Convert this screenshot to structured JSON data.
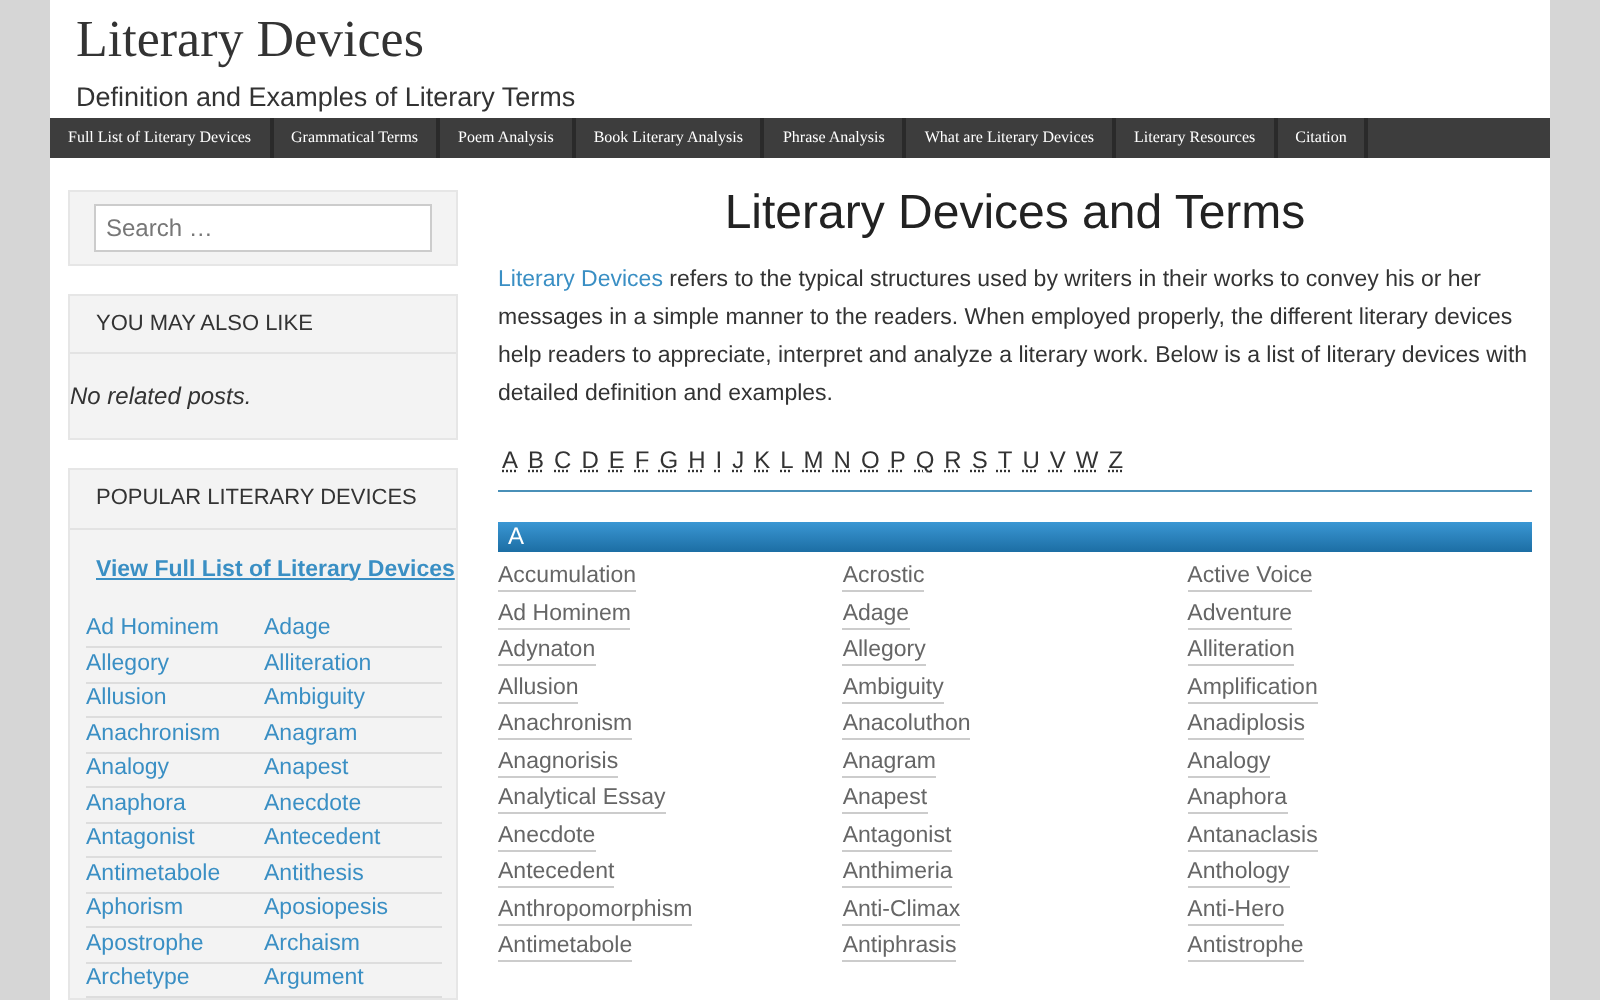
{
  "site": {
    "title": "Literary Devices",
    "tagline": "Definition and Examples of Literary Terms"
  },
  "nav": [
    "Full List of Literary Devices",
    "Grammatical Terms",
    "Poem Analysis",
    "Book Literary Analysis",
    "Phrase Analysis",
    "What are Literary Devices",
    "Literary Resources",
    "Citation"
  ],
  "sidebar": {
    "search": {
      "placeholder": "Search …"
    },
    "related": {
      "heading": "YOU MAY ALSO LIKE",
      "text": "No related posts."
    },
    "popular": {
      "heading": "POPULAR LITERARY DEVICES",
      "link": "View Full List of Literary Devices",
      "items": [
        "Ad Hominem",
        "Adage",
        "Allegory",
        "Alliteration",
        "Allusion",
        "Ambiguity",
        "Anachronism",
        "Anagram",
        "Analogy",
        "Anapest",
        "Anaphora",
        "Anecdote",
        "Antagonist",
        "Antecedent",
        "Antimetabole",
        "Antithesis",
        "Aphorism",
        "Aposiopesis",
        "Apostrophe",
        "Archaism",
        "Archetype",
        "Argument"
      ]
    }
  },
  "main": {
    "title": "Literary Devices and Terms",
    "intro_link": "Literary Devices",
    "intro": " refers to the typical structures used by writers in their works to convey his or her messages in a simple manner to the readers.  When employed properly, the different literary devices help readers to appreciate, interpret and analyze a literary work. Below is a list of literary devices with detailed definition and examples.",
    "letters": [
      "A",
      "B",
      "C",
      "D",
      "E",
      "F",
      "G",
      "H",
      "I",
      "J",
      "K",
      "L",
      "M",
      "N",
      "O",
      "P",
      "Q",
      "R",
      "S",
      "T",
      "U",
      "V",
      "W",
      "Z"
    ],
    "section": {
      "heading": "A",
      "terms": [
        "Accumulation",
        "Acrostic",
        "Active Voice",
        "Ad Hominem",
        "Adage",
        "Adventure",
        "Adynaton",
        "Allegory",
        "Alliteration",
        "Allusion",
        "Ambiguity",
        "Amplification",
        "Anachronism",
        "Anacoluthon",
        "Anadiplosis",
        "Anagnorisis",
        "Anagram",
        "Analogy",
        "Analytical Essay",
        "Anapest",
        "Anaphora",
        "Anecdote",
        "Antagonist",
        "Antanaclasis",
        "Antecedent",
        "Anthimeria",
        "Anthology",
        "Anthropomorphism",
        "Anti-Climax",
        "Anti-Hero",
        "Antimetabole",
        "Antiphrasis",
        "Antistrophe"
      ]
    }
  }
}
